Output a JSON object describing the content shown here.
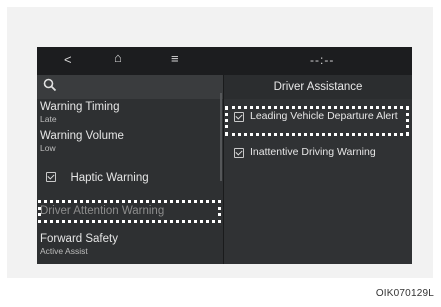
{
  "statusbar": {
    "back_icon": "<",
    "home_icon": "⌂",
    "menu_icon": "≡",
    "signal_icon": "--:--"
  },
  "left_panel": {
    "items": [
      {
        "title": "Warning Timing",
        "sub": "Late"
      },
      {
        "title": "Warning Volume",
        "sub": "Low"
      },
      {
        "title": "Haptic Warning"
      },
      {
        "title": "Driver Attention Warning"
      },
      {
        "title": "Forward Safety",
        "sub": "Active Assist"
      }
    ]
  },
  "right_panel": {
    "title": "Driver Assistance",
    "options": [
      {
        "label": "Leading Vehicle Departure Alert"
      },
      {
        "label": "Inattentive Driving Warning"
      }
    ]
  },
  "caption": "OIK070129L"
}
